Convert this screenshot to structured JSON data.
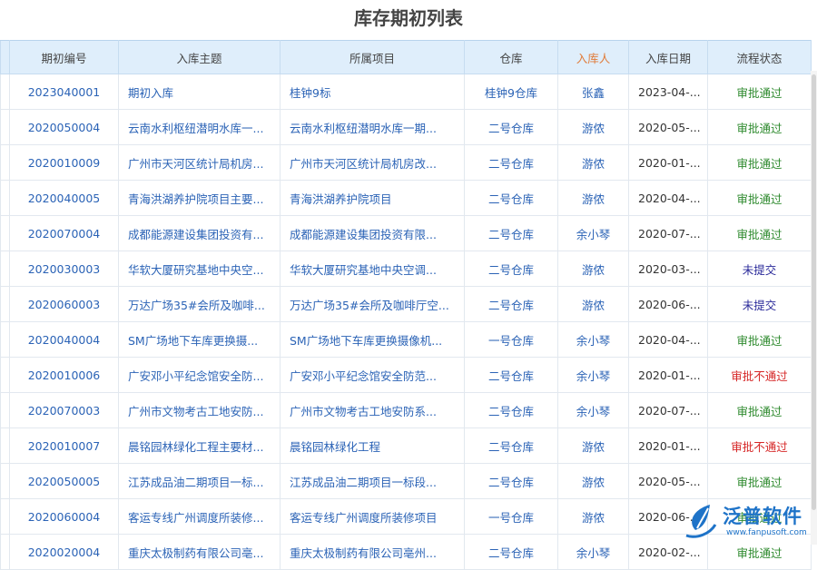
{
  "page": {
    "title": "库存期初列表"
  },
  "columns": [
    {
      "key": "code",
      "label": "期初编号"
    },
    {
      "key": "subject",
      "label": "入库主题"
    },
    {
      "key": "project",
      "label": "所属项目"
    },
    {
      "key": "warehouse",
      "label": "仓库"
    },
    {
      "key": "person",
      "label": "入库人"
    },
    {
      "key": "date",
      "label": "入库日期"
    },
    {
      "key": "status",
      "label": "流程状态"
    }
  ],
  "colors": {
    "header_bg": "#dfeefb",
    "link": "#2b63b6",
    "highlight_header": "#e07b39",
    "status_approved": "#2e8a2e",
    "status_draft": "#2a2a9a",
    "status_rejected": "#d62828"
  },
  "rows": [
    {
      "code": "2023040001",
      "subject": "期初入库",
      "project": "桂钟9标",
      "warehouse": "桂钟9仓库",
      "person": "张鑫",
      "date": "2023-04-...",
      "status": "审批通过",
      "status_type": "ok"
    },
    {
      "code": "2020050004",
      "subject": "云南水利枢纽潜明水库一...",
      "project": "云南水利枢纽潜明水库一期...",
      "warehouse": "二号仓库",
      "person": "游侬",
      "date": "2020-05-...",
      "status": "审批通过",
      "status_type": "ok"
    },
    {
      "code": "2020010009",
      "subject": "广州市天河区统计局机房...",
      "project": "广州市天河区统计局机房改...",
      "warehouse": "二号仓库",
      "person": "游侬",
      "date": "2020-01-...",
      "status": "审批通过",
      "status_type": "ok"
    },
    {
      "code": "2020040005",
      "subject": "青海洪湖养护院项目主要...",
      "project": "青海洪湖养护院项目",
      "warehouse": "二号仓库",
      "person": "游侬",
      "date": "2020-04-...",
      "status": "审批通过",
      "status_type": "ok"
    },
    {
      "code": "2020070004",
      "subject": "成都能源建设集团投资有...",
      "project": "成都能源建设集团投资有限...",
      "warehouse": "二号仓库",
      "person": "余小琴",
      "date": "2020-07-...",
      "status": "审批通过",
      "status_type": "ok"
    },
    {
      "code": "2020030003",
      "subject": "华软大厦研究基地中央空...",
      "project": "华软大厦研究基地中央空调...",
      "warehouse": "二号仓库",
      "person": "游侬",
      "date": "2020-03-...",
      "status": "未提交",
      "status_type": "draft"
    },
    {
      "code": "2020060003",
      "subject": "万达广场35#会所及咖啡...",
      "project": "万达广场35#会所及咖啡厅空...",
      "warehouse": "二号仓库",
      "person": "游侬",
      "date": "2020-06-...",
      "status": "未提交",
      "status_type": "draft"
    },
    {
      "code": "2020040004",
      "subject": "SM广场地下车库更换摄...",
      "project": "SM广场地下车库更换摄像机...",
      "warehouse": "一号仓库",
      "person": "余小琴",
      "date": "2020-04-...",
      "status": "审批通过",
      "status_type": "ok"
    },
    {
      "code": "2020010006",
      "subject": "广安邓小平纪念馆安全防...",
      "project": "广安邓小平纪念馆安全防范...",
      "warehouse": "二号仓库",
      "person": "余小琴",
      "date": "2020-01-...",
      "status": "审批不通过",
      "status_type": "rej"
    },
    {
      "code": "2020070003",
      "subject": "广州市文物考古工地安防...",
      "project": "广州市文物考古工地安防系...",
      "warehouse": "二号仓库",
      "person": "余小琴",
      "date": "2020-07-...",
      "status": "审批通过",
      "status_type": "ok"
    },
    {
      "code": "2020010007",
      "subject": "晨铭园林绿化工程主要材...",
      "project": "晨铭园林绿化工程",
      "warehouse": "二号仓库",
      "person": "游侬",
      "date": "2020-01-...",
      "status": "审批不通过",
      "status_type": "rej"
    },
    {
      "code": "2020050005",
      "subject": "江苏成品油二期项目一标...",
      "project": "江苏成品油二期项目一标段...",
      "warehouse": "二号仓库",
      "person": "游侬",
      "date": "2020-05-...",
      "status": "审批通过",
      "status_type": "ok"
    },
    {
      "code": "2020060004",
      "subject": "客运专线广州调度所装修...",
      "project": "客运专线广州调度所装修项目",
      "warehouse": "一号仓库",
      "person": "游侬",
      "date": "2020-06-...",
      "status": "审批通过",
      "status_type": "ok"
    },
    {
      "code": "2020020004",
      "subject": "重庆太极制药有限公司亳...",
      "project": "重庆太极制药有限公司亳州...",
      "warehouse": "二号仓库",
      "person": "余小琴",
      "date": "2020-02-...",
      "status": "审批通过",
      "status_type": "ok"
    }
  ],
  "brand": {
    "name": "泛普软件",
    "url": "www.fanpusoft.com",
    "icon": "leaf-logo-icon"
  }
}
